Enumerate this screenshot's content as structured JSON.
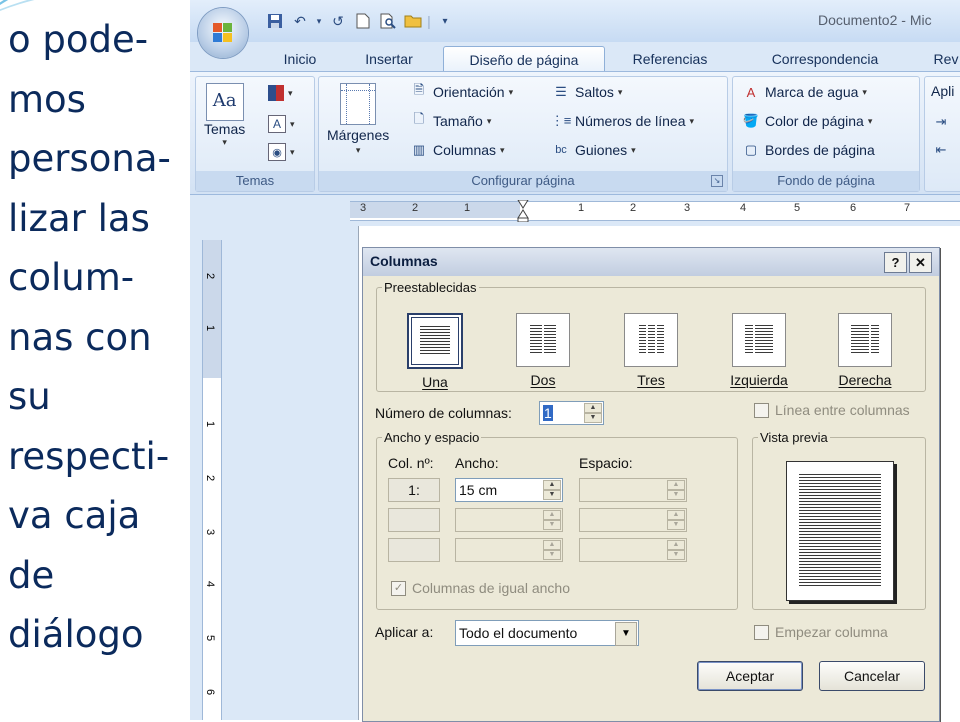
{
  "slide": {
    "lines": [
      "o pode-",
      "mos",
      "persona-",
      "lizar las",
      "colum-",
      "nas con",
      "su",
      "respecti-",
      "va caja",
      "de",
      "diálogo"
    ]
  },
  "word": {
    "document_title": "Documento2 - Mic",
    "tabs": [
      "Inicio",
      "Insertar",
      "Diseño de página",
      "Referencias",
      "Correspondencia",
      "Rev"
    ],
    "active_tab": "Diseño de página",
    "ribbon": {
      "temas": {
        "label": "Temas",
        "button": "Temas"
      },
      "configurar": {
        "label": "Configurar página",
        "margenes": "Márgenes",
        "orientacion": "Orientación",
        "tamano": "Tamaño",
        "columnas": "Columnas",
        "saltos": "Saltos",
        "numeros_linea": "Números de línea",
        "guiones": "Guiones"
      },
      "fondo": {
        "label": "Fondo de página",
        "marca_agua": "Marca de agua",
        "color_pagina": "Color de página",
        "bordes_pagina": "Bordes de página"
      },
      "aplicar_partial": "Apli"
    },
    "ruler_h_numbers": [
      "3",
      "2",
      "1",
      "1",
      "2",
      "3",
      "4",
      "5",
      "6",
      "7"
    ],
    "ruler_v_numbers": [
      "2",
      "1",
      "1",
      "2",
      "3",
      "4",
      "5",
      "6"
    ]
  },
  "dialog": {
    "title": "Columnas",
    "help_btn": "?",
    "close_btn": "✕",
    "presets_legend": "Preestablecidas",
    "presets": [
      "Una",
      "Dos",
      "Tres",
      "Izquierda",
      "Derecha"
    ],
    "selected_preset": "Una",
    "num_cols_label": "Número de columnas:",
    "num_cols_value": "1",
    "linea_entre": "Línea entre columnas",
    "ancho_legend": "Ancho y espacio",
    "col_header": "Col. nº:",
    "ancho_header": "Ancho:",
    "espacio_header": "Espacio:",
    "row1_col": "1:",
    "row1_ancho": "15 cm",
    "igual_ancho": "Columnas de igual ancho",
    "preview_legend": "Vista previa",
    "aplicar_label": "Aplicar a:",
    "aplicar_value": "Todo el documento",
    "empezar": "Empezar columna",
    "aceptar": "Aceptar",
    "cancelar": "Cancelar"
  }
}
